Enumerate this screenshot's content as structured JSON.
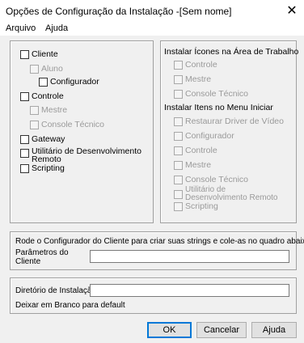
{
  "window": {
    "title": "Opções de Configuração da Instalação -[Sem nome]",
    "close_glyph": "✕"
  },
  "menu": {
    "items": [
      "Arquivo",
      "Ajuda"
    ]
  },
  "components": {
    "items": [
      {
        "label": "Cliente",
        "enabled": true
      },
      {
        "label": "Aluno",
        "enabled": false
      },
      {
        "label": "Configurador",
        "enabled": true
      },
      {
        "label": "Controle",
        "enabled": true
      },
      {
        "label": "Mestre",
        "enabled": false
      },
      {
        "label": "Console Técnico",
        "enabled": false
      },
      {
        "label": "Gateway",
        "enabled": true
      },
      {
        "label": "Utilitário de Desenvolvimento Remoto",
        "enabled": true
      },
      {
        "label": "Scripting",
        "enabled": true
      }
    ]
  },
  "desktop_icons": {
    "header": "Instalar Ícones na Área de Trabalho",
    "items": [
      "Controle",
      "Mestre",
      "Console Técnico"
    ]
  },
  "start_menu": {
    "header": "Instalar Itens no Menu Iniciar",
    "items": [
      "Restaurar Driver de Vídeo",
      "Configurador",
      "Controle",
      "Mestre",
      "Console Técnico",
      "Utilitário de Desenvolvimento Remoto",
      "Scripting"
    ]
  },
  "client_params": {
    "instruction": "Rode o Configurador do Cliente para criar suas strings e cole-as no quadro abaixo.",
    "label": "Parâmetros do Cliente",
    "value": ""
  },
  "install_dir": {
    "label": "Diretório de Instalação",
    "value": "",
    "hint": "Deixar em Branco para default"
  },
  "buttons": {
    "ok": "OK",
    "cancel": "Cancelar",
    "help": "Ajuda"
  },
  "colors": {
    "dialog_bg": "#f0f0f0",
    "default_button_border": "#0078d7",
    "disabled_text": "#9a9a9a"
  }
}
